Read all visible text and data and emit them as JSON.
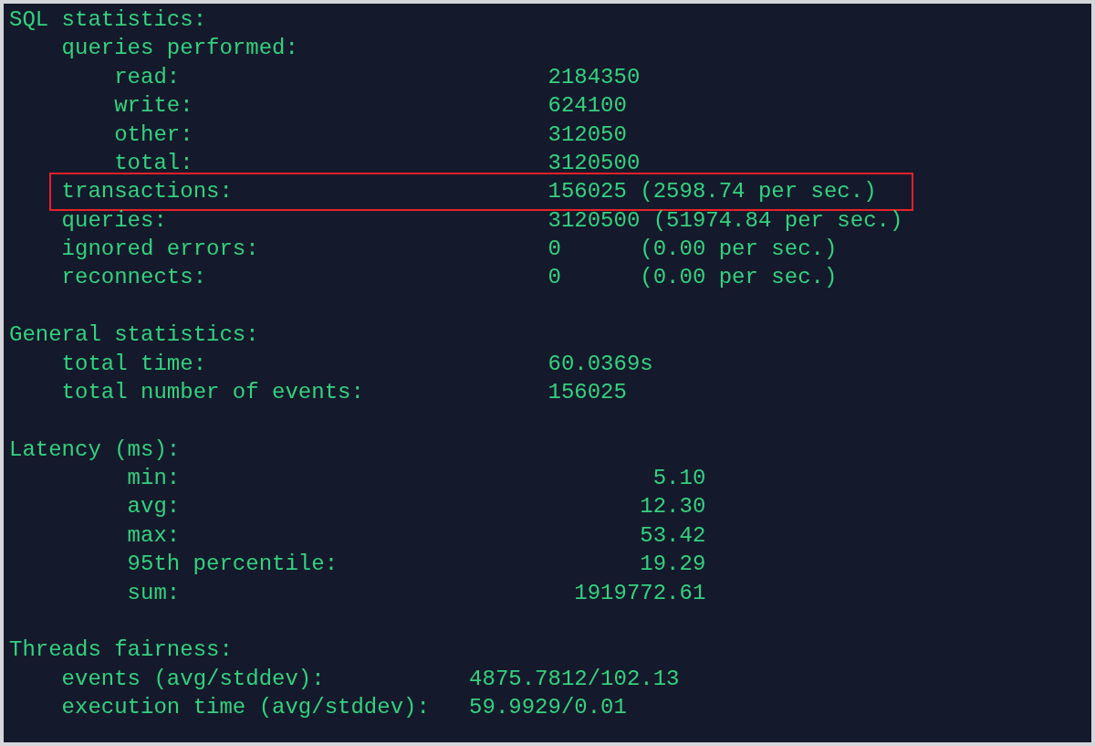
{
  "sections": [
    {
      "kind": "stat",
      "title": "SQL statistics:",
      "items": [
        {
          "label": "queries performed:",
          "highlighted": false,
          "children": [
            {
              "label": "read:",
              "value": "2184350"
            },
            {
              "label": "write:",
              "value": "624100"
            },
            {
              "label": "other:",
              "value": "312050"
            },
            {
              "label": "total:",
              "value": "3120500"
            }
          ]
        },
        {
          "label": "transactions:",
          "value": "156025 (2598.74 per sec.)",
          "highlighted": true
        },
        {
          "label": "queries:",
          "value": "3120500 (51974.84 per sec.)",
          "highlighted": false
        },
        {
          "label": "ignored errors:",
          "value": "0      (0.00 per sec.)",
          "highlighted": false
        },
        {
          "label": "reconnects:",
          "value": "0      (0.00 per sec.)",
          "highlighted": false
        }
      ]
    },
    {
      "kind": "stat",
      "title": "General statistics:",
      "items": [
        {
          "label": "total time:",
          "value": "60.0369s",
          "highlighted": false
        },
        {
          "label": "total number of events:",
          "value": "156025",
          "highlighted": false
        }
      ]
    },
    {
      "kind": "latency",
      "title": "Latency (ms):",
      "items": [
        {
          "label": "min:",
          "value": "5.10",
          "highlighted": false
        },
        {
          "label": "avg:",
          "value": "12.30",
          "highlighted": false
        },
        {
          "label": "max:",
          "value": "53.42",
          "highlighted": false
        },
        {
          "label": "95th percentile:",
          "value": "19.29",
          "highlighted": false
        },
        {
          "label": "sum:",
          "value": "1919772.61",
          "highlighted": false
        }
      ]
    },
    {
      "kind": "fairness",
      "title": "Threads fairness:",
      "items": [
        {
          "label": "events (avg/stddev):",
          "value": "4875.7812/102.13",
          "highlighted": false
        },
        {
          "label": "execution time (avg/stddev):",
          "value": "59.9929/0.01",
          "highlighted": false
        }
      ]
    }
  ]
}
